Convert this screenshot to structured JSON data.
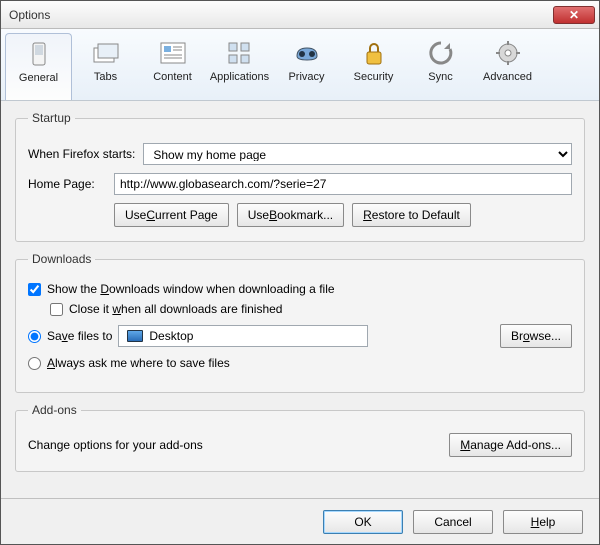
{
  "window": {
    "title": "Options"
  },
  "tabs": [
    {
      "label": "General"
    },
    {
      "label": "Tabs"
    },
    {
      "label": "Content"
    },
    {
      "label": "Applications"
    },
    {
      "label": "Privacy"
    },
    {
      "label": "Security"
    },
    {
      "label": "Sync"
    },
    {
      "label": "Advanced"
    }
  ],
  "startup": {
    "legend": "Startup",
    "when_label": "When Firefox starts:",
    "when_value": "Show my home page",
    "homepage_label": "Home Page:",
    "homepage_value": "http://www.globasearch.com/?serie=27",
    "use_current": "Use Current Page",
    "use_bookmark": "Use Bookmark...",
    "restore_default": "Restore to Default"
  },
  "downloads": {
    "legend": "Downloads",
    "show_window": "Show the Downloads window when downloading a file",
    "close_when_done": "Close it when all downloads are finished",
    "save_to": "Save files to",
    "save_location": "Desktop",
    "browse": "Browse...",
    "always_ask": "Always ask me where to save files"
  },
  "addons": {
    "legend": "Add-ons",
    "desc": "Change options for your add-ons",
    "manage": "Manage Add-ons..."
  },
  "footer": {
    "ok": "OK",
    "cancel": "Cancel",
    "help": "Help"
  }
}
